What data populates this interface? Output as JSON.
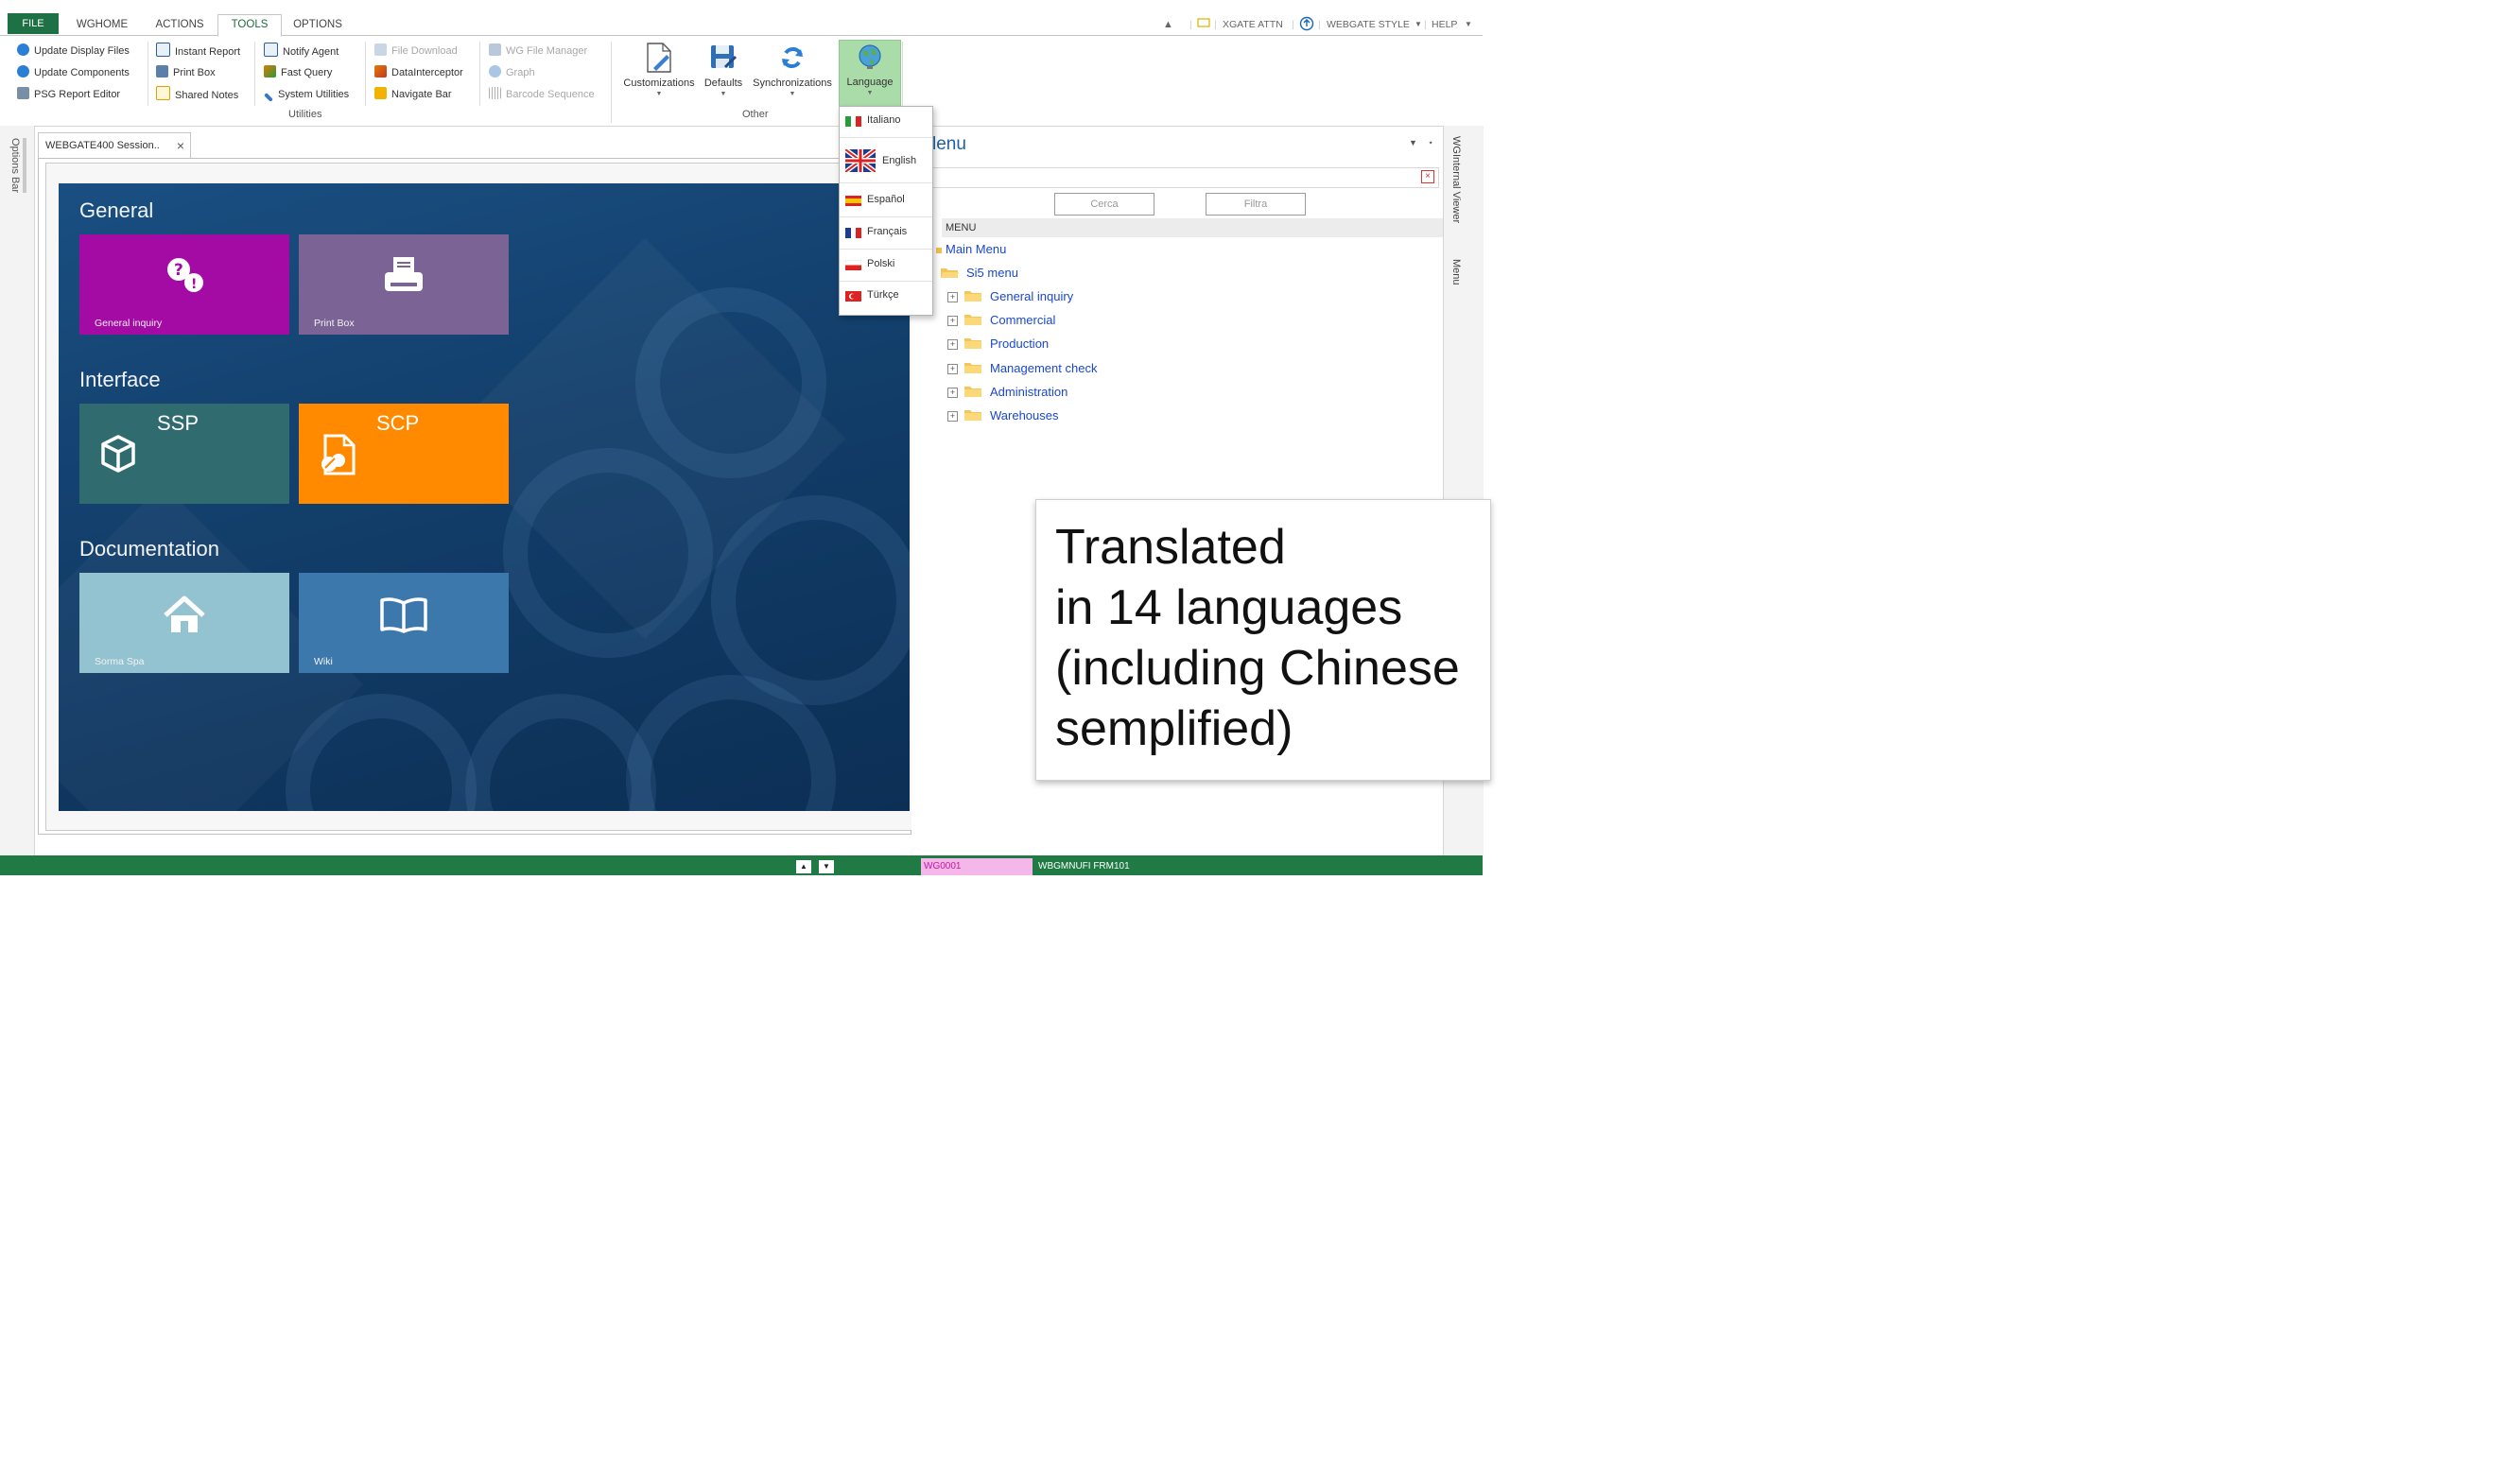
{
  "ribbon_tabs": {
    "file": "FILE",
    "wghome": "WGHOME",
    "actions": "ACTIONS",
    "tools": "TOOLS",
    "options": "OPTIONS"
  },
  "ribbon_right": {
    "xgate": "XGATE ATTN",
    "style": "WEBGATE STYLE",
    "help": "HELP"
  },
  "ribbon": {
    "col1": [
      "Update Display Files",
      "Update Components",
      "PSG Report Editor"
    ],
    "col2": [
      "Instant Report",
      "Print Box",
      "Shared Notes"
    ],
    "col3": [
      "Notify Agent",
      "Fast Query",
      "System Utilities"
    ],
    "col4": [
      "File Download",
      "DataInterceptor",
      "Navigate Bar"
    ],
    "col5": [
      "WG File Manager",
      "Graph",
      "Barcode Sequence"
    ],
    "group_utilities": "Utilities",
    "big": [
      "Customizations",
      "Defaults",
      "Synchronizations",
      "Language"
    ],
    "group_other": "Other"
  },
  "languages": [
    "Italiano",
    "English",
    "Español",
    "Français",
    "Polski",
    "Türkçe"
  ],
  "options_bar": "Options Bar",
  "session_tab": "WEBGATE400 Session..",
  "dashboard": {
    "sections": [
      "General",
      "Interface",
      "Documentation"
    ],
    "tiles": {
      "general_inquiry": "General inquiry",
      "print_box": "Print Box",
      "ssp": "SSP",
      "scp": "SCP",
      "sorma": "Sorma Spa",
      "wiki": "Wiki"
    },
    "colors": {
      "purple": "#a40aa4",
      "mauve": "#7b6396",
      "teal": "#2f6b6f",
      "orange": "#ff8a00",
      "lightblue": "#93c3d0",
      "steel": "#3d78ad"
    }
  },
  "menu_panel": {
    "title": "lenu",
    "search_button": "Cerca",
    "filter_button": "Filtra",
    "header": "MENU",
    "root": "Main Menu",
    "sub": "Si5 menu",
    "items": [
      "General inquiry",
      "Commercial",
      "Production",
      "Management check",
      "Administration",
      "Warehouses"
    ]
  },
  "right_strip": {
    "viewer": "WGInternal Viewer",
    "menu": "Menu"
  },
  "status": {
    "code": "WG0001",
    "text": "WBGMNUFI  FRM101"
  },
  "callout": {
    "lines": [
      "Translated",
      "in 14 languages",
      "(including Chinese",
      "semplified)"
    ]
  }
}
